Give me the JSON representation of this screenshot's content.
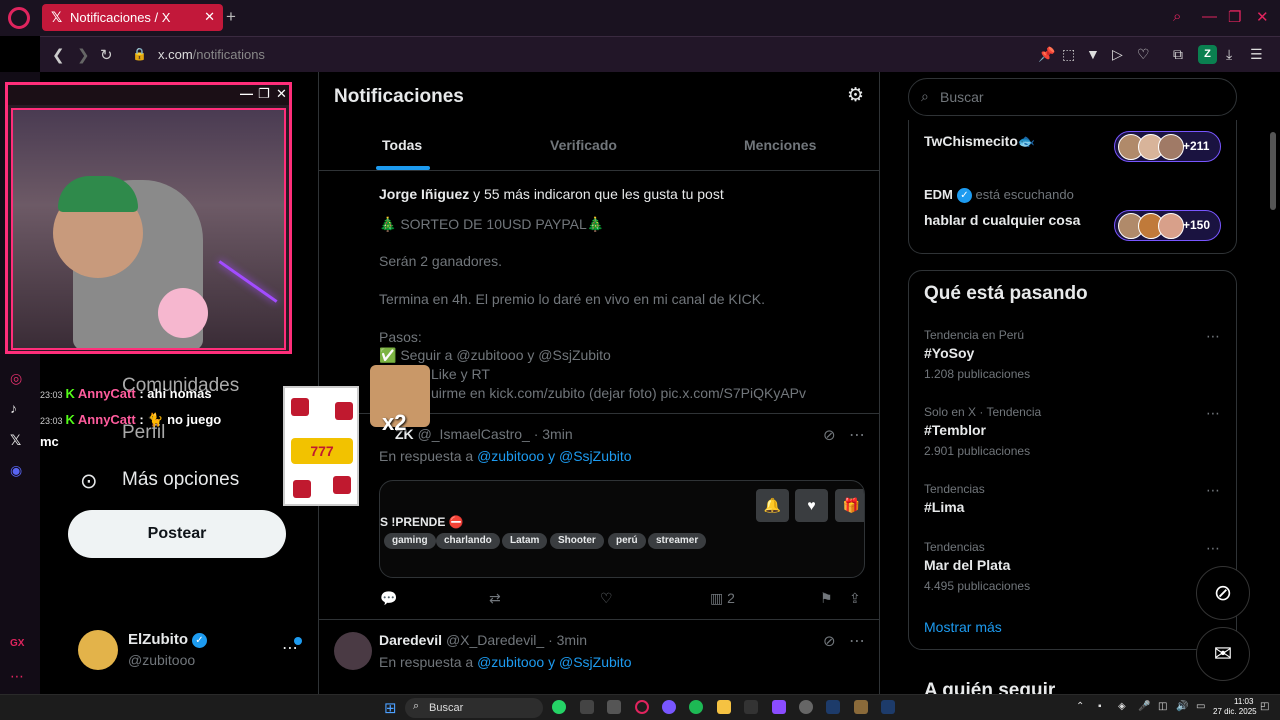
{
  "browser": {
    "tab_title": "Notificaciones / X",
    "url_host": "x.com",
    "url_path": "/notifications",
    "profile_letter": "Z"
  },
  "nav": {
    "communities": "Comunidades",
    "profile": "Perfil",
    "more_options": "Más opciones",
    "post_button": "Postear"
  },
  "account": {
    "name": "ElZubito",
    "handle": "@zubitooo"
  },
  "chat": [
    {
      "time": "23:03",
      "user": "AnnyCatt",
      "message": ": ahi nomas"
    },
    {
      "time": "23:03",
      "user": "AnnyCatt",
      "message": ": 🐈 no juego"
    },
    {
      "continuation": "mc"
    }
  ],
  "main": {
    "title": "Notificaciones",
    "tabs": [
      "Todas",
      "Verificado",
      "Menciones"
    ],
    "like_notification": {
      "user": "Jorge Iñiguez",
      "text": " y 55 más indicaron que les gusta tu post"
    },
    "post_lines": [
      "🎄 SORTEO DE 10USD PAYPAL🎄",
      "Serán 2 ganadores.",
      "Termina en 4h. El premio lo daré en vivo en mi canal de KICK.",
      "Pasos:",
      "✅ Seguir a @zubitooo y @SsjZubito",
      "Like y RT",
      "uirme en kick.com/zubito (dejar foto) pic.x.com/S7PiQKyAPv"
    ],
    "reply1": {
      "name": "ZK",
      "handle": "@_IsmaelCastro_",
      "time": "· 3min",
      "in_reply": "En respuesta a ",
      "targets": "@zubitooo y @SsjZubito"
    },
    "card": {
      "title": "S !PRENDE ⛔",
      "tags": [
        "gaming",
        "charlando",
        "Latam",
        "Shooter",
        "perú",
        "streamer"
      ]
    },
    "views": "2",
    "reply2": {
      "name": "Daredevil",
      "handle": "@X_Daredevil_",
      "time": "· 3min",
      "in_reply": "En respuesta a ",
      "targets": "@zubitooo y @SsjZubito"
    }
  },
  "right": {
    "search_placeholder": "Buscar",
    "spaces": [
      {
        "title": "TwChismecito🐟",
        "count": "+211"
      },
      {
        "host": "EDM",
        "host_suffix": " está escuchando",
        "title": "hablar d cualquier cosa",
        "count": "+150"
      }
    ],
    "trends_title": "Qué está pasando",
    "trends": [
      {
        "context": "Tendencia en Perú",
        "name": "#YoSoy",
        "count": "1.208 publicaciones"
      },
      {
        "context": "Solo en X · Tendencia",
        "name": "#Temblor",
        "count": "2.901 publicaciones"
      },
      {
        "context": "Tendencias",
        "name": "#Lima",
        "count": ""
      },
      {
        "context": "Tendencias",
        "name": "Mar del Plata",
        "count": "4.495 publicaciones"
      }
    ],
    "show_more": "Mostrar más",
    "who_to_follow": "A quién seguir"
  },
  "overlays": {
    "slot_text": "777",
    "cat_badge": "x2"
  },
  "taskbar": {
    "search_placeholder": "Buscar",
    "time": "11:03",
    "date": "27 dic. 2025"
  },
  "colors": {
    "x_blue": "#1d9bf0",
    "opera_red": "#e0245e",
    "spaces_purple": "#7856ff"
  }
}
